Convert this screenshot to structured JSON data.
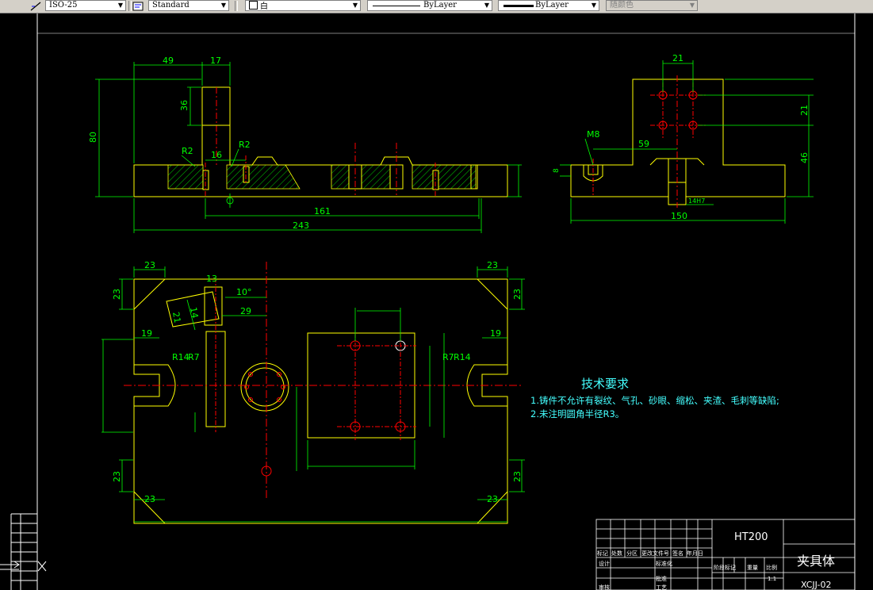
{
  "toolbar": {
    "dimstyle": "ISO-25",
    "textstyle": "Standard",
    "color_select": "白",
    "linetype": "ByLayer",
    "lineweight": "ByLayer",
    "plotstyle": "随颜色"
  },
  "notes": {
    "title": "技术要求",
    "line1": "1.铸件不允许有裂纹、气孔、砂眼、缩松、夹渣、毛刺等缺陷;",
    "line2": "2.未注明圆角半径R3。"
  },
  "title_block": {
    "material": "HT200",
    "part_name": "夹具体",
    "drawing_no": "XCJJ-02",
    "scale": "1:1",
    "labels": [
      "标记",
      "处数",
      "分区",
      "更改文件号",
      "签名",
      "年月日",
      "设计",
      "标准化",
      "阶段标记",
      "重量",
      "比例",
      "审核",
      "工艺",
      "批准"
    ]
  },
  "dims": {
    "front": [
      "49",
      "17",
      "36",
      "80",
      "R2",
      "16",
      "R2",
      "161",
      "243"
    ],
    "side": [
      "21",
      "21",
      "46",
      "M8",
      "59",
      "8",
      "14H7",
      "150"
    ],
    "top": [
      "23",
      "23",
      "23",
      "23",
      "23",
      "23",
      "23",
      "23",
      "19",
      "19",
      "R14",
      "R14",
      "R7",
      "R7",
      "10°",
      "29",
      "21",
      "14",
      "13"
    ]
  }
}
